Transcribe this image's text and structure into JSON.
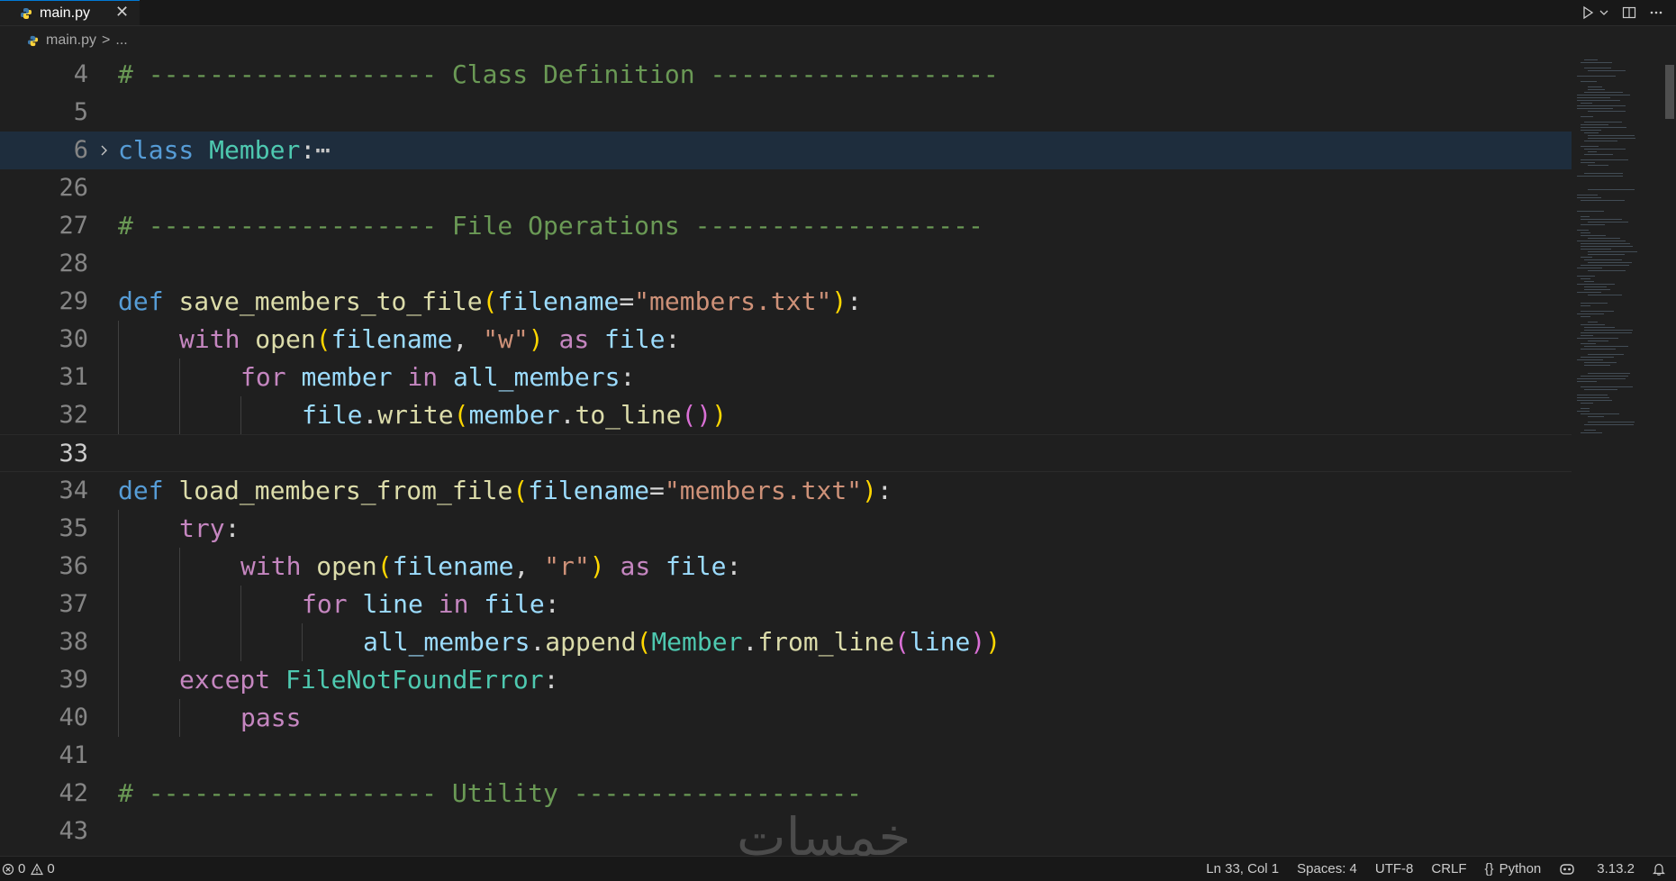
{
  "tab": {
    "label": "main.py",
    "close_glyph": "✕"
  },
  "breadcrumb": {
    "file": "main.py",
    "separator": ">",
    "more": "..."
  },
  "editor": {
    "lines": [
      {
        "num": "4"
      },
      {
        "num": "5"
      },
      {
        "num": "6"
      },
      {
        "num": "26"
      },
      {
        "num": "27"
      },
      {
        "num": "28"
      },
      {
        "num": "29"
      },
      {
        "num": "30"
      },
      {
        "num": "31"
      },
      {
        "num": "32"
      },
      {
        "num": "33"
      },
      {
        "num": "34"
      },
      {
        "num": "35"
      },
      {
        "num": "36"
      },
      {
        "num": "37"
      },
      {
        "num": "38"
      },
      {
        "num": "39"
      },
      {
        "num": "40"
      },
      {
        "num": "41"
      },
      {
        "num": "42"
      },
      {
        "num": "43"
      }
    ],
    "code": {
      "l4": "# ------------------- Class Definition -------------------",
      "l6_kw": "class",
      "l6_name": "Member",
      "l6_colon": ":",
      "l6_fold": "⋯",
      "l27": "# ------------------- File Operations -------------------",
      "l29_kw": "def",
      "l29_fn": "save_members_to_file",
      "l29_p1": "(",
      "l29_param": "filename",
      "l29_eq": "=",
      "l29_str": "\"members.txt\"",
      "l29_p2": ")",
      "l29_colon": ":",
      "l30_kw": "with",
      "l30_fn": "open",
      "l30_p1": "(",
      "l30_var": "filename",
      "l30_comma": ", ",
      "l30_str": "\"w\"",
      "l30_p2": ")",
      "l30_as": "as",
      "l30_file": "file",
      "l30_colon": ":",
      "l31_kw": "for",
      "l31_var": "member",
      "l31_in": "in",
      "l31_coll": "all_members",
      "l31_colon": ":",
      "l32_obj": "file",
      "l32_dot": ".",
      "l32_fn": "write",
      "l32_p1": "(",
      "l32_var": "member",
      "l32_dot2": ".",
      "l32_fn2": "to_line",
      "l32_p2": "()",
      "l32_p3": ")",
      "l34_kw": "def",
      "l34_fn": "load_members_from_file",
      "l34_p1": "(",
      "l34_param": "filename",
      "l34_eq": "=",
      "l34_str": "\"members.txt\"",
      "l34_p2": ")",
      "l34_colon": ":",
      "l35_kw": "try",
      "l35_colon": ":",
      "l36_kw": "with",
      "l36_fn": "open",
      "l36_p1": "(",
      "l36_var": "filename",
      "l36_comma": ", ",
      "l36_str": "\"r\"",
      "l36_p2": ")",
      "l36_as": "as",
      "l36_file": "file",
      "l36_colon": ":",
      "l37_kw": "for",
      "l37_var": "line",
      "l37_in": "in",
      "l37_file": "file",
      "l37_colon": ":",
      "l38_obj": "all_members",
      "l38_dot": ".",
      "l38_fn": "append",
      "l38_p1": "(",
      "l38_cls": "Member",
      "l38_dot2": ".",
      "l38_fn2": "from_line",
      "l38_p2": "(",
      "l38_var": "line",
      "l38_p3": ")",
      "l38_p4": ")",
      "l39_kw": "except",
      "l39_cls": "FileNotFoundError",
      "l39_colon": ":",
      "l40_kw": "pass",
      "l42": "# ------------------- Utility -------------------"
    }
  },
  "watermark": "خمسات",
  "statusbar": {
    "errors": "0",
    "warnings": "0",
    "position": "Ln 33, Col 1",
    "spaces": "Spaces: 4",
    "encoding": "UTF-8",
    "eol": "CRLF",
    "language_braces": "{}",
    "language": "Python",
    "version": "3.13.2"
  },
  "colors": {
    "background": "#1f1f1f",
    "comment": "#6a9955",
    "keyword": "#569cd6",
    "control": "#c586c0",
    "class": "#4ec9b0",
    "function": "#dcdcaa",
    "variable": "#9cdcfe",
    "string": "#ce9178"
  },
  "icons": [
    "python-file-icon",
    "close-icon",
    "run-icon",
    "chevron-down-icon",
    "split-editor-icon",
    "more-actions-icon",
    "error-icon",
    "warning-icon",
    "copilot-icon",
    "bell-icon"
  ]
}
